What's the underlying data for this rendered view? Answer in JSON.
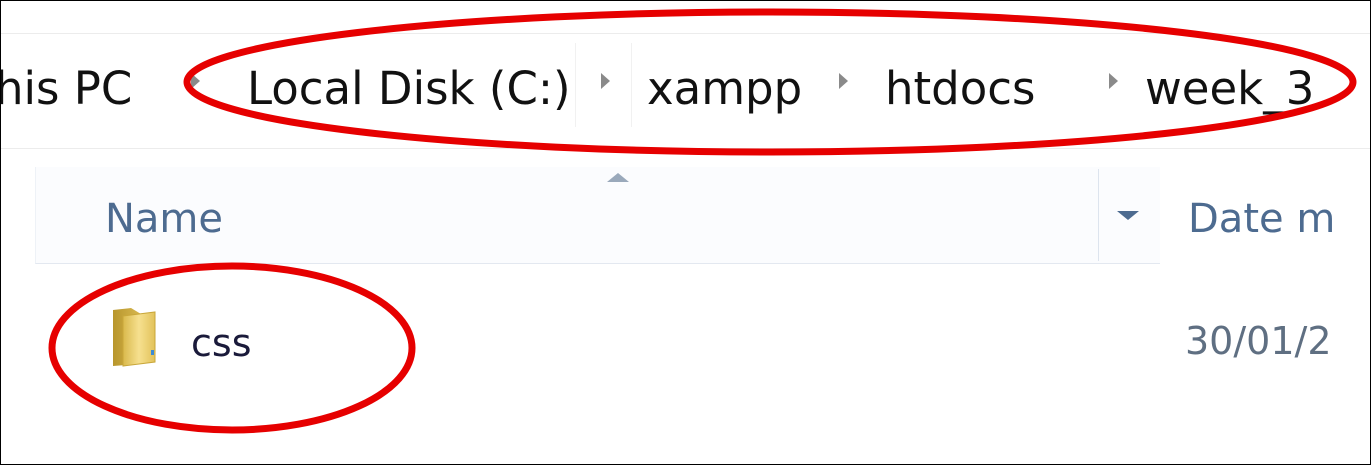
{
  "breadcrumb": {
    "items": [
      "his PC",
      "Local Disk (C:)",
      "xampp",
      "htdocs",
      "week_3"
    ]
  },
  "columns": {
    "name_label": "Name",
    "date_label": "Date m"
  },
  "files": [
    {
      "name": "css",
      "date": "30/01/2",
      "icon": "folder-icon"
    }
  ],
  "annotation": {
    "color": "#e60000"
  }
}
